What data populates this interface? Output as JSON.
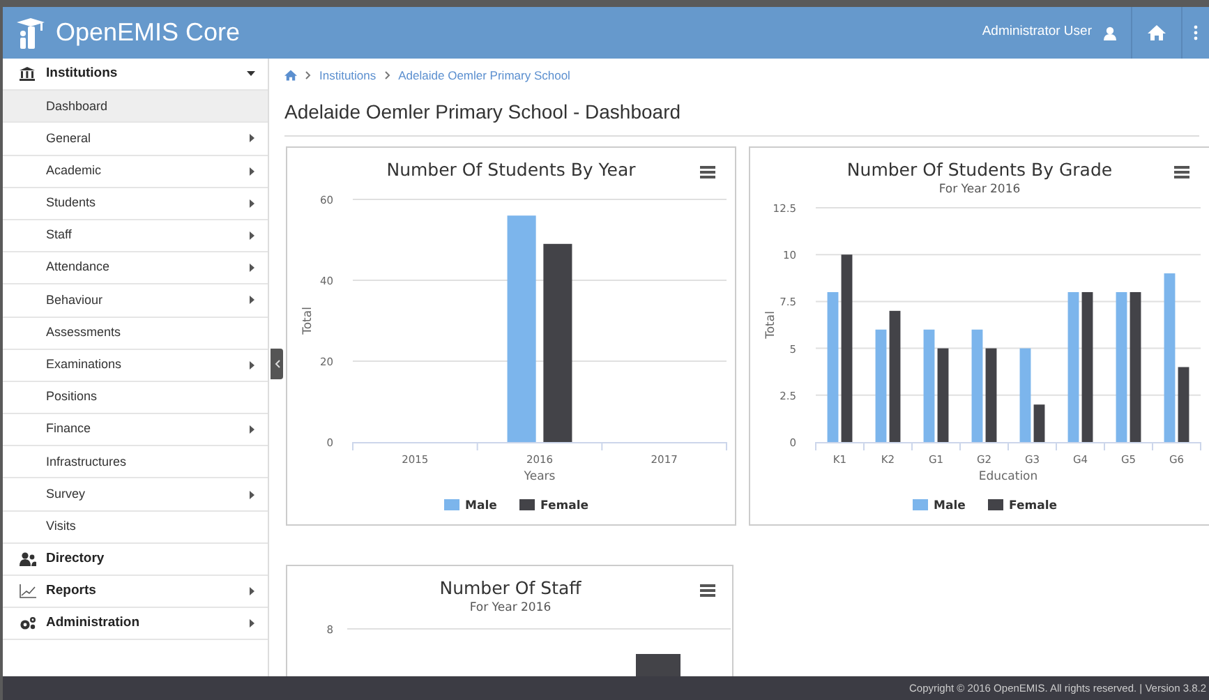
{
  "header": {
    "app_name": "OpenEMIS Core",
    "user": "Administrator User"
  },
  "sidebar": {
    "sections": [
      {
        "label": "Institutions",
        "has_submenu": true,
        "expanded": true,
        "items": [
          {
            "label": "Dashboard",
            "selected": true,
            "has_submenu": false
          },
          {
            "label": "General",
            "selected": false,
            "has_submenu": true
          },
          {
            "label": "Academic",
            "selected": false,
            "has_submenu": true
          },
          {
            "label": "Students",
            "selected": false,
            "has_submenu": true
          },
          {
            "label": "Staff",
            "selected": false,
            "has_submenu": true
          },
          {
            "label": "Attendance",
            "selected": false,
            "has_submenu": true
          },
          {
            "label": "Behaviour",
            "selected": false,
            "has_submenu": true
          },
          {
            "label": "Assessments",
            "selected": false,
            "has_submenu": false
          },
          {
            "label": "Examinations",
            "selected": false,
            "has_submenu": true
          },
          {
            "label": "Positions",
            "selected": false,
            "has_submenu": false
          },
          {
            "label": "Finance",
            "selected": false,
            "has_submenu": true
          },
          {
            "label": "Infrastructures",
            "selected": false,
            "has_submenu": false
          },
          {
            "label": "Survey",
            "selected": false,
            "has_submenu": true
          },
          {
            "label": "Visits",
            "selected": false,
            "has_submenu": false
          }
        ]
      },
      {
        "label": "Directory",
        "has_submenu": false,
        "expanded": false
      },
      {
        "label": "Reports",
        "has_submenu": true,
        "expanded": false
      },
      {
        "label": "Administration",
        "has_submenu": true,
        "expanded": false
      }
    ]
  },
  "breadcrumb": [
    "Institutions",
    "Adelaide Oemler Primary School"
  ],
  "page_title": "Adelaide Oemler Primary School - Dashboard",
  "charts": [
    {
      "chart_data": {
        "type": "bar",
        "title": "Number Of Students By Year",
        "xlabel": "Years",
        "ylabel": "Total",
        "categories": [
          "2015",
          "2016",
          "2017"
        ],
        "series": [
          {
            "name": "Male",
            "color": "#7cb5ec",
            "values": [
              null,
              56,
              null
            ]
          },
          {
            "name": "Female",
            "color": "#434348",
            "values": [
              null,
              49,
              null
            ]
          }
        ],
        "ylim": [
          0,
          60
        ],
        "yticks": [
          0,
          20,
          40,
          60
        ],
        "grid": true,
        "legend": "bottom"
      }
    },
    {
      "subtitle": "For Year 2016",
      "chart_data": {
        "type": "bar",
        "title": "Number Of Students By Grade",
        "xlabel": "Education",
        "ylabel": "Total",
        "categories": [
          "K1",
          "K2",
          "G1",
          "G2",
          "G3",
          "G4",
          "G5",
          "G6"
        ],
        "series": [
          {
            "name": "Male",
            "color": "#7cb5ec",
            "values": [
              8,
              6,
              6,
              6,
              5,
              8,
              8,
              9
            ]
          },
          {
            "name": "Female",
            "color": "#434348",
            "values": [
              10,
              7,
              5,
              5,
              2,
              8,
              8,
              4
            ]
          }
        ],
        "ylim": [
          0,
          12.5
        ],
        "yticks": [
          0,
          2.5,
          5,
          7.5,
          10,
          12.5
        ],
        "grid": true,
        "legend": "bottom"
      }
    }
  ],
  "staff_chart": {
    "title": "Number Of Staff",
    "subtitle": "For Year 2016",
    "ytick_label": "8"
  },
  "footer": "Copyright © 2016 OpenEMIS. All rights reserved. | Version 3.8.2"
}
